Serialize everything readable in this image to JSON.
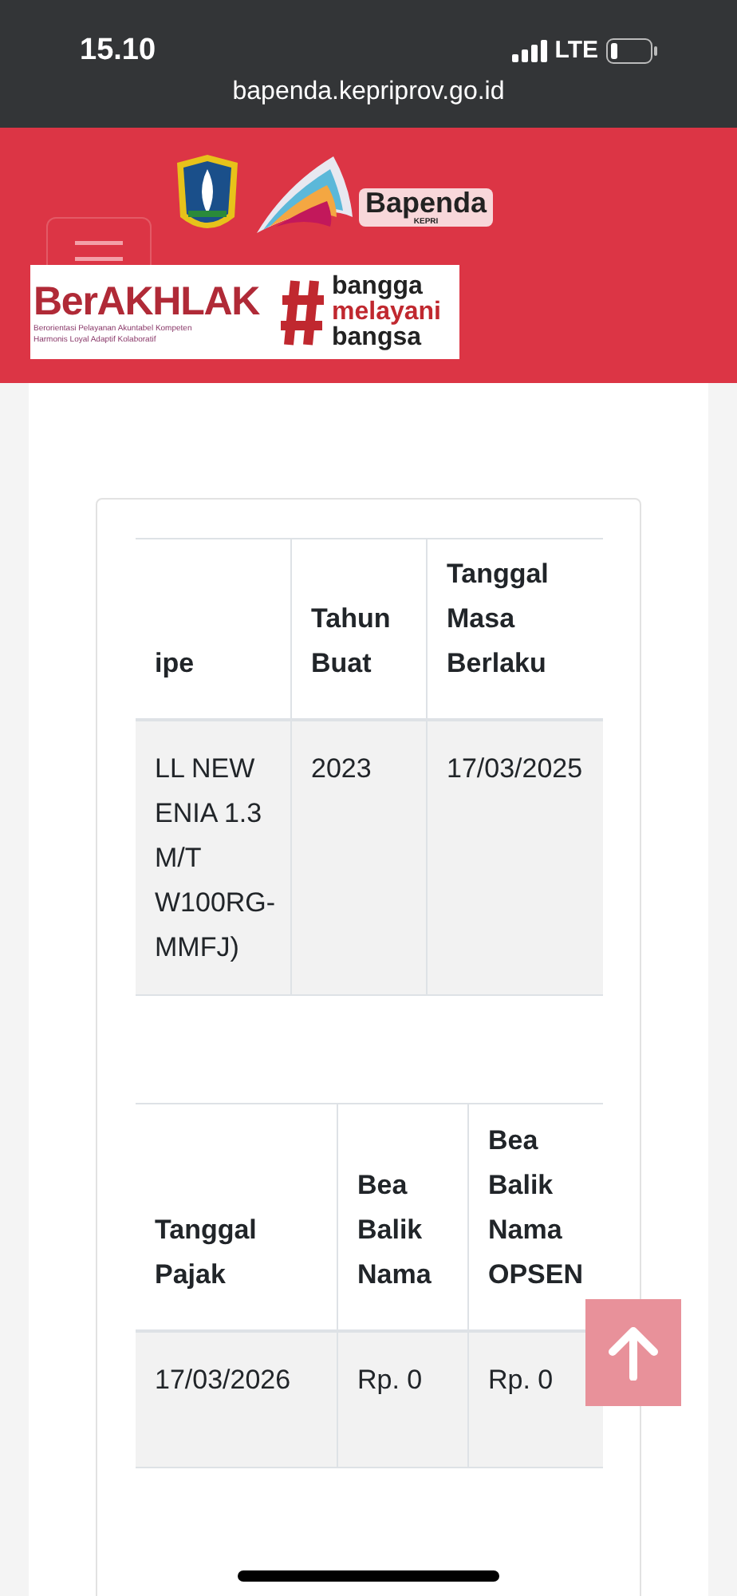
{
  "status_bar": {
    "time": "15.10",
    "network": "LTE"
  },
  "address_bar": {
    "url": "bapenda.kepriprov.go.id"
  },
  "header": {
    "logo_text": "Bapenda",
    "logo_subtext": "KEPRI",
    "banner": {
      "title": "BerAKHLAK",
      "subtitle_lines": [
        "Berorientasi Pelayanan Akuntabel Kompeten",
        "Harmonis Loyal Adaptif Kolaboratif"
      ],
      "tagline": [
        "bangga",
        "melayani",
        "bangsa"
      ]
    }
  },
  "tables": [
    {
      "columns": [
        "ipe",
        "Tahun\nBuat",
        "Tanggal\nMasa\nBerlaku"
      ],
      "rows": [
        [
          "LL NEW\nENIA 1.3\nM/T\nW100RG-\nMMFJ)",
          "2023",
          "17/03/2025"
        ]
      ]
    },
    {
      "columns": [
        "Tanggal\nPajak",
        "Bea\nBalik\nNama",
        "Bea\nBalik\nNama\nOPSEN"
      ],
      "rows": [
        [
          "17/03/2026",
          "Rp. 0",
          "Rp. 0"
        ]
      ]
    }
  ]
}
